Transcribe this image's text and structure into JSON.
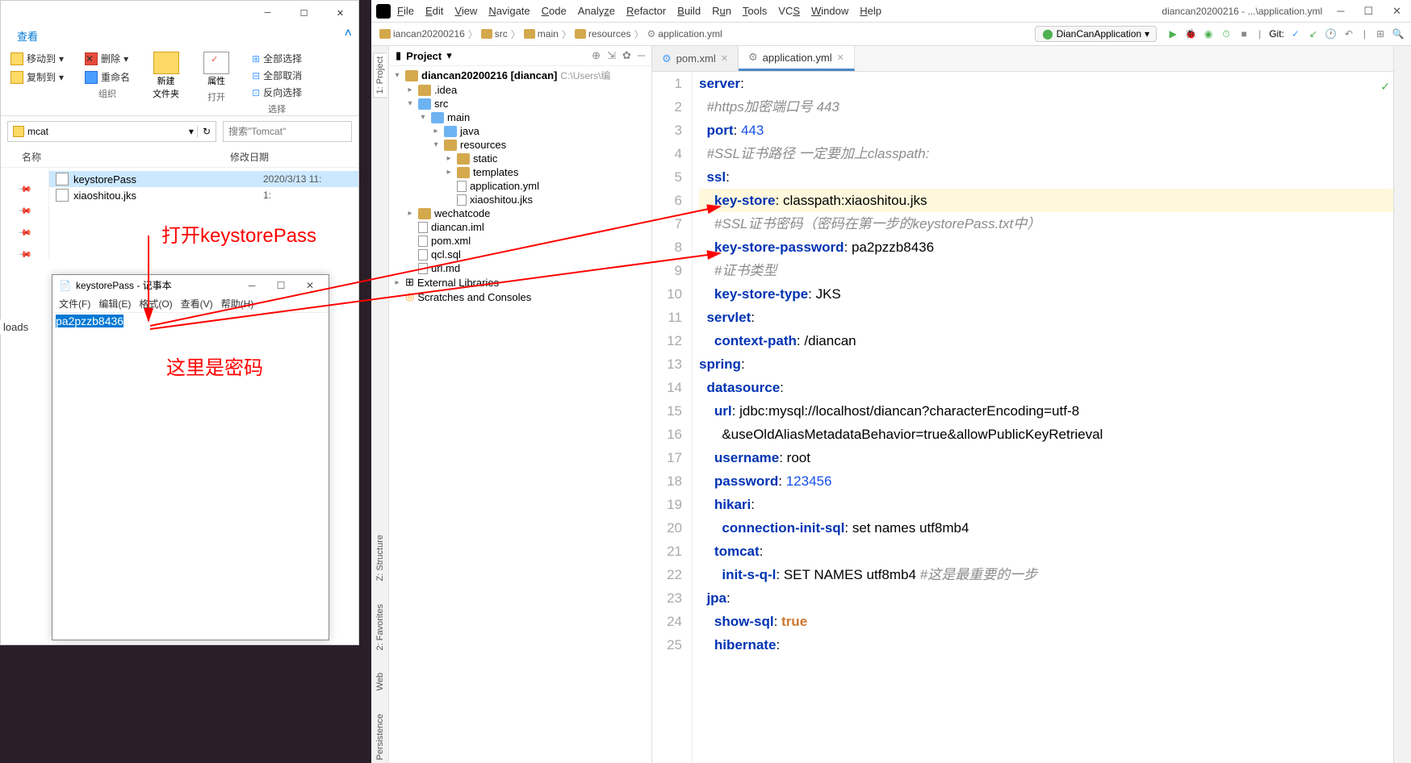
{
  "explorer": {
    "ribbon_tab": "查看",
    "ribbon": {
      "move_to": "移动到",
      "copy_to": "复制到",
      "delete": "删除",
      "rename": "重命名",
      "new_folder": "新建\n文件夹",
      "properties": "属性",
      "open": "打开",
      "select_all": "全部选择",
      "select_none": "全部取消",
      "invert": "反向选择",
      "group_org": "组织",
      "group_open": "打开",
      "group_select": "选择"
    },
    "addr": "mcat",
    "search_placeholder": "搜索\"Tomcat\"",
    "col_name": "名称",
    "col_date": "修改日期",
    "files": [
      {
        "name": "keystorePass",
        "date": "2020/3/13 11:",
        "selected": true
      },
      {
        "name": "xiaoshitou.jks",
        "date": "1:",
        "selected": false
      }
    ]
  },
  "downloads": "loads",
  "notepad": {
    "title": "keystorePass - 记事本",
    "menu": {
      "file": "文件(F)",
      "edit": "编辑(E)",
      "format": "格式(O)",
      "view": "查看(V)",
      "help": "帮助(H)"
    },
    "content": "pa2pzzb8436"
  },
  "ide": {
    "menu": {
      "file": "File",
      "edit": "Edit",
      "view": "View",
      "navigate": "Navigate",
      "code": "Code",
      "analyze": "Analyze",
      "refactor": "Refactor",
      "build": "Build",
      "run": "Run",
      "tools": "Tools",
      "vcs": "VCS",
      "window": "Window",
      "help": "Help"
    },
    "title": "diancan20200216 - ...\\application.yml",
    "breadcrumb": [
      "iancan20200216",
      "src",
      "main",
      "resources",
      "application.yml"
    ],
    "run_config": "DianCanApplication",
    "git_label": "Git:",
    "project_label": "Project",
    "leftbar": {
      "project": "1: Project",
      "structure": "Z: Structure",
      "favorites": "2: Favorites",
      "web": "Web",
      "persistence": "Persistence"
    },
    "tree": [
      {
        "d": 0,
        "a": "▾",
        "t": "folder",
        "label": "diancan20200216 [diancan]",
        "extra": "C:\\Users\\编"
      },
      {
        "d": 1,
        "a": "▸",
        "t": "folder",
        "label": ".idea"
      },
      {
        "d": 1,
        "a": "▾",
        "t": "folder blue",
        "label": "src"
      },
      {
        "d": 2,
        "a": "▾",
        "t": "folder blue",
        "label": "main"
      },
      {
        "d": 3,
        "a": "▸",
        "t": "folder blue",
        "label": "java"
      },
      {
        "d": 3,
        "a": "▾",
        "t": "folder",
        "label": "resources"
      },
      {
        "d": 4,
        "a": "▸",
        "t": "folder",
        "label": "static"
      },
      {
        "d": 4,
        "a": "▸",
        "t": "folder",
        "label": "templates"
      },
      {
        "d": 4,
        "a": "",
        "t": "file",
        "label": "application.yml"
      },
      {
        "d": 4,
        "a": "",
        "t": "file",
        "label": "xiaoshitou.jks"
      },
      {
        "d": 1,
        "a": "▸",
        "t": "folder",
        "label": "wechatcode"
      },
      {
        "d": 1,
        "a": "",
        "t": "file",
        "label": "diancan.iml"
      },
      {
        "d": 1,
        "a": "",
        "t": "file",
        "label": "pom.xml"
      },
      {
        "d": 1,
        "a": "",
        "t": "file",
        "label": "qcl.sql"
      },
      {
        "d": 1,
        "a": "",
        "t": "file",
        "label": "url.md"
      },
      {
        "d": 0,
        "a": "▸",
        "t": "lib",
        "label": "External Libraries"
      },
      {
        "d": 0,
        "a": "",
        "t": "scratch",
        "label": "Scratches and Consoles"
      }
    ],
    "tabs": [
      {
        "label": "pom.xml",
        "active": false
      },
      {
        "label": "application.yml",
        "active": true
      }
    ],
    "code_lines": [
      {
        "n": 1,
        "html": "<span class='key'>server</span>:"
      },
      {
        "n": 2,
        "html": "  <span class='cmt'>#https加密端口号 443</span>"
      },
      {
        "n": 3,
        "html": "  <span class='key'>port</span>: <span class='num'>443</span>"
      },
      {
        "n": 4,
        "html": "  <span class='cmt'>#SSL证书路径 一定要加上classpath:</span>"
      },
      {
        "n": 5,
        "html": "  <span class='key'>ssl</span>:"
      },
      {
        "n": 6,
        "html": "    <span class='key'>key-store</span>: classpath:xiaoshitou.jks",
        "hl": true
      },
      {
        "n": 7,
        "html": "    <span class='cmt'>#SSL证书密码（密码在第一步的keystorePass.txt中）</span>"
      },
      {
        "n": 8,
        "html": "    <span class='key'>key-store-password</span>: pa2pzzb8436"
      },
      {
        "n": 9,
        "html": "    <span class='cmt'>#证书类型</span>"
      },
      {
        "n": 10,
        "html": "    <span class='key'>key-store-type</span>: JKS"
      },
      {
        "n": 11,
        "html": "  <span class='key'>servlet</span>:"
      },
      {
        "n": 12,
        "html": "    <span class='key'>context-path</span>: /diancan"
      },
      {
        "n": 13,
        "html": "<span class='key'>spring</span>:"
      },
      {
        "n": 14,
        "html": "  <span class='key'>datasource</span>:"
      },
      {
        "n": 15,
        "html": "    <span class='key'>url</span>: jdbc:mysql://localhost/diancan?characterEncoding=utf-8"
      },
      {
        "n": 16,
        "html": "      &useOldAliasMetadataBehavior=true&allowPublicKeyRetrieval"
      },
      {
        "n": 17,
        "html": "    <span class='key'>username</span>: root"
      },
      {
        "n": 18,
        "html": "    <span class='key'>password</span>: <span class='num'>123456</span>"
      },
      {
        "n": 19,
        "html": "    <span class='key'>hikari</span>:"
      },
      {
        "n": 20,
        "html": "      <span class='key'>connection-init-sql</span>: set names utf8mb4"
      },
      {
        "n": 21,
        "html": "    <span class='key'>tomcat</span>:"
      },
      {
        "n": 22,
        "html": "      <span class='key'>init-s-q-l</span>: SET NAMES utf8mb4 <span class='cmt'>#这是最重要的一步</span>"
      },
      {
        "n": 23,
        "html": "  <span class='key'>jpa</span>:"
      },
      {
        "n": 24,
        "html": "    <span class='key'>show-sql</span>: <span class='kw'>true</span>"
      },
      {
        "n": 25,
        "html": "    <span class='key'>hibernate</span>:"
      }
    ]
  },
  "annotations": {
    "open_file": "打开keystorePass",
    "password_here": "这里是密码"
  }
}
